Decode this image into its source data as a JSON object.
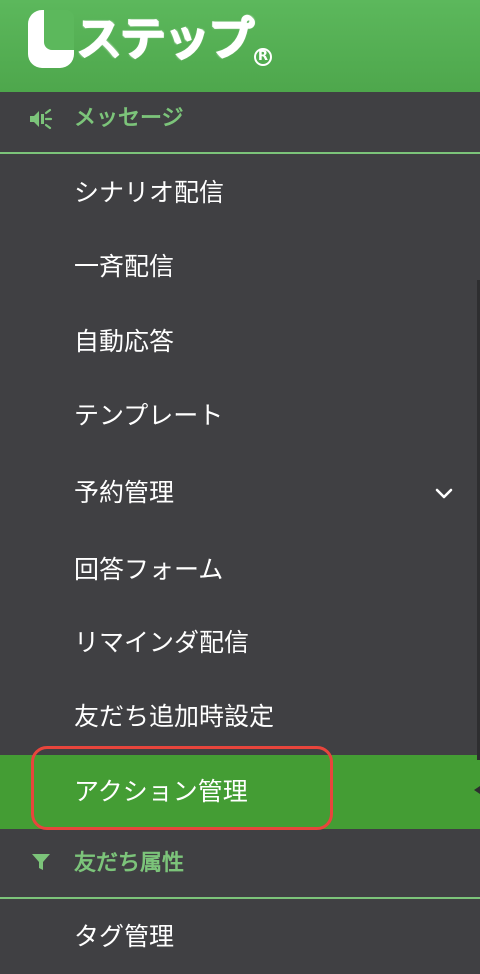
{
  "header": {
    "logo_text": "ステップ",
    "logo_registered": "R"
  },
  "sections": {
    "message": {
      "label": "メッセージ",
      "icon": "megaphone-icon",
      "items": [
        {
          "label": "シナリオ配信"
        },
        {
          "label": "一斉配信"
        },
        {
          "label": "自動応答"
        },
        {
          "label": "テンプレート"
        },
        {
          "label": "予約管理",
          "has_submenu": true
        },
        {
          "label": "回答フォーム"
        },
        {
          "label": "リマインダ配信"
        },
        {
          "label": "友だち追加時設定"
        },
        {
          "label": "アクション管理",
          "active": true
        }
      ]
    },
    "friend_attr": {
      "label": "友だち属性",
      "icon": "filter-icon",
      "items": [
        {
          "label": "タグ管理"
        }
      ]
    }
  },
  "colors": {
    "sidebar_bg": "#404043",
    "header_green": "#5cb85c",
    "section_green": "#7cc47a",
    "active_bg": "#449d34",
    "highlight_red": "#e8453c",
    "text": "#ffffff"
  }
}
